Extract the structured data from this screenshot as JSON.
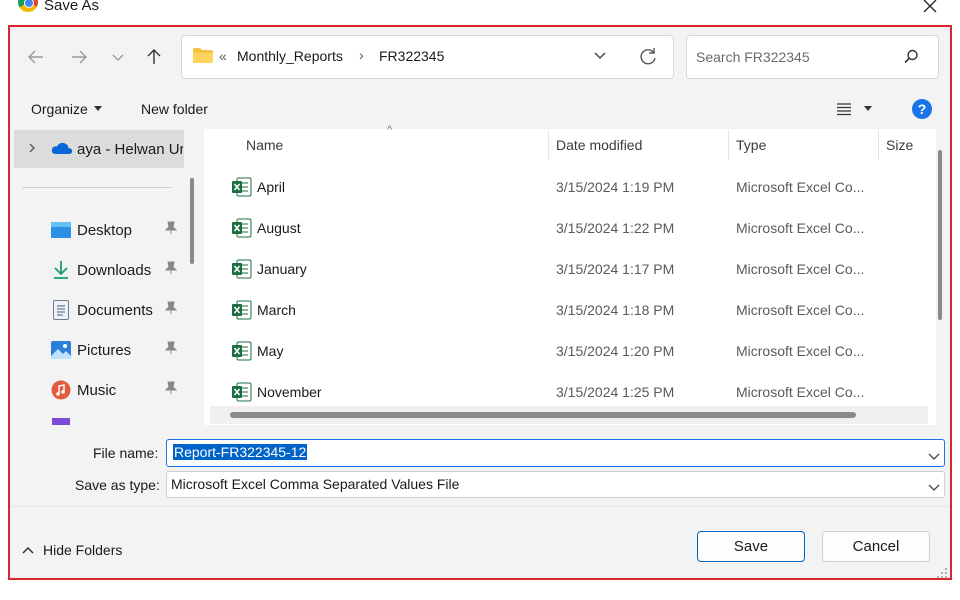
{
  "window": {
    "title": "Save As"
  },
  "address": {
    "crumbs": [
      "Monthly_Reports",
      "FR322345"
    ],
    "overflow_marker": "«",
    "separator": "›"
  },
  "search": {
    "placeholder": "Search  FR322345"
  },
  "toolbar": {
    "organize_label": "Organize",
    "new_folder_label": "New folder",
    "help_label": "?"
  },
  "nav": {
    "onedrive_label": "aya - Helwan Ur",
    "items": [
      {
        "label": "Desktop",
        "icon": "desktop-icon"
      },
      {
        "label": "Downloads",
        "icon": "downloads-icon"
      },
      {
        "label": "Documents",
        "icon": "documents-icon"
      },
      {
        "label": "Pictures",
        "icon": "pictures-icon"
      },
      {
        "label": "Music",
        "icon": "music-icon"
      }
    ]
  },
  "columns": {
    "name": "Name",
    "date": "Date modified",
    "type": "Type",
    "size": "Size"
  },
  "files": [
    {
      "name": "April",
      "date": "3/15/2024 1:19 PM",
      "type": "Microsoft Excel Co..."
    },
    {
      "name": "August",
      "date": "3/15/2024 1:22 PM",
      "type": "Microsoft Excel Co..."
    },
    {
      "name": "January",
      "date": "3/15/2024 1:17 PM",
      "type": "Microsoft Excel Co..."
    },
    {
      "name": "March",
      "date": "3/15/2024 1:18 PM",
      "type": "Microsoft Excel Co..."
    },
    {
      "name": "May",
      "date": "3/15/2024 1:20 PM",
      "type": "Microsoft Excel Co..."
    },
    {
      "name": "November",
      "date": "3/15/2024 1:25 PM",
      "type": "Microsoft Excel Co..."
    }
  ],
  "form": {
    "file_name_label": "File name:",
    "file_name_value": "Report-FR322345-12",
    "save_type_label": "Save as type:",
    "save_type_value": "Microsoft Excel Comma Separated Values File"
  },
  "footer": {
    "hide_folders_label": "Hide Folders",
    "save_label": "Save",
    "cancel_label": "Cancel"
  },
  "colors": {
    "accent": "#0067c0",
    "selection": "#0063c8",
    "highlight_frame": "#d9272e",
    "excel_green": "#1d6f42"
  }
}
